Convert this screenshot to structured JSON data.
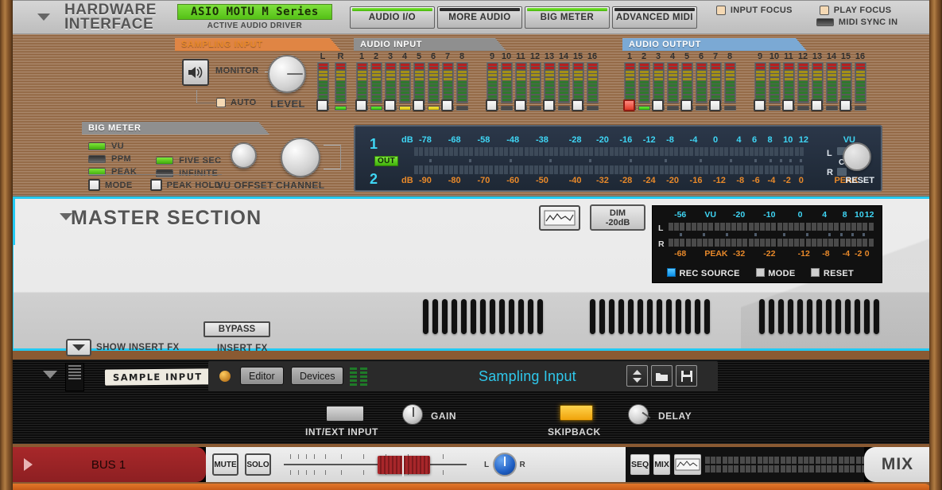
{
  "hardware": {
    "title_line1": "HARDWARE",
    "title_line2": "INTERFACE",
    "driver_value": "ASIO MOTU M Series",
    "driver_caption": "ACTIVE AUDIO DRIVER",
    "nav_buttons": [
      {
        "label": "AUDIO I/O",
        "active": true
      },
      {
        "label": "MORE AUDIO",
        "active": false
      },
      {
        "label": "BIG METER",
        "active": true
      },
      {
        "label": "ADVANCED MIDI",
        "active": false
      }
    ],
    "focus_options": [
      {
        "label": "INPUT FOCUS",
        "type": "square"
      },
      {
        "label": "PLAY FOCUS",
        "type": "square"
      },
      {
        "label": "MIDI SYNC IN",
        "type": "wide"
      }
    ]
  },
  "sampling_input": {
    "banner": "SAMPLING INPUT",
    "monitor_label": "MONITOR",
    "auto_label": "AUTO",
    "level_label": "LEVEL",
    "channels": [
      "L",
      "R"
    ],
    "clip_leds": [
      "green",
      "green"
    ]
  },
  "audio_input": {
    "banner": "AUDIO INPUT",
    "channels": [
      "1",
      "2",
      "3",
      "4",
      "5",
      "6",
      "7",
      "8",
      "9",
      "10",
      "11",
      "12",
      "13",
      "14",
      "15",
      "16"
    ],
    "clip_leds": [
      "green",
      "green",
      "yellow",
      "yellow",
      "yellow",
      "yellow",
      "off",
      "off",
      "off",
      "off",
      "off",
      "off",
      "off",
      "off",
      "off",
      "off"
    ]
  },
  "audio_output": {
    "banner": "AUDIO OUTPUT",
    "channels": [
      "1",
      "2",
      "3",
      "4",
      "5",
      "6",
      "7",
      "8",
      "9",
      "10",
      "11",
      "12",
      "13",
      "14",
      "15",
      "16"
    ],
    "clip_leds": [
      "green",
      "green",
      "off",
      "off",
      "off",
      "off",
      "off",
      "off",
      "off",
      "off",
      "off",
      "off",
      "off",
      "off",
      "off",
      "off"
    ],
    "checkbox_active_index": 0
  },
  "big_meter": {
    "banner": "BIG METER",
    "leds": [
      {
        "label": "VU",
        "on": true
      },
      {
        "label": "PPM",
        "on": false
      },
      {
        "label": "PEAK",
        "on": true
      },
      {
        "label": "FIVE SEC",
        "on": true
      },
      {
        "label": "INFINITE",
        "on": false
      }
    ],
    "checkboxes": [
      {
        "label": "MODE"
      },
      {
        "label": "PEAK HOLD"
      }
    ],
    "vu_offset_label": "VU OFFSET",
    "channel_label": "CHANNEL",
    "reset_label": "RESET",
    "display": {
      "row1_number": "1",
      "row2_number": "2",
      "out_badge": "OUT",
      "vu_unit": "dB",
      "vu_scale": [
        "-78",
        "-68",
        "-58",
        "-48",
        "-38",
        "-28",
        "-20",
        "-16",
        "-12",
        "-8",
        "-4",
        "0",
        "4",
        "6",
        "8",
        "10",
        "12"
      ],
      "vu_suffix": "VU",
      "peak_unit": "dB",
      "peak_scale": [
        "-90",
        "-80",
        "-70",
        "-60",
        "-50",
        "-40",
        "-32",
        "-28",
        "-24",
        "-20",
        "-16",
        "-12",
        "-8",
        "-6",
        "-4",
        "-2",
        "0"
      ],
      "peak_suffix": "PEAK",
      "left_label": "L",
      "right_label": "R",
      "clip_label": "CLIP"
    }
  },
  "master_section": {
    "title": "MASTER SECTION",
    "dim_line1": "DIM",
    "dim_line2": "-20dB",
    "show_insert_fx": "SHOW INSERT FX",
    "bypass": "BYPASS",
    "insert_fx": "INSERT FX",
    "meter": {
      "left_label": "L",
      "right_label": "R",
      "vu_scale": [
        "-56",
        "VU",
        "-20",
        "-10",
        "0",
        "4",
        "8",
        "10",
        "12"
      ],
      "peak_scale": [
        "-68",
        "PEAK",
        "-32",
        "-22",
        "-12",
        "-8",
        "-4",
        "-2",
        "0"
      ],
      "options": [
        {
          "label": "REC SOURCE",
          "on": true
        },
        {
          "label": "MODE",
          "on": false
        },
        {
          "label": "RESET",
          "on": false
        }
      ]
    }
  },
  "sampler": {
    "tag": "SAMPLE INPUT",
    "editor_button": "Editor",
    "devices_button": "Devices",
    "title": "Sampling Input",
    "int_ext_label": "INT/EXT INPUT",
    "gain_label": "GAIN",
    "skipback_label": "SKIPBACK",
    "delay_label": "DELAY"
  },
  "bus": {
    "name": "BUS 1",
    "mute": "MUTE",
    "solo": "SOLO",
    "pan_left": "L",
    "pan_right": "R",
    "seq": "SEQ",
    "mix_small": "MIX",
    "mix_big": "MIX"
  },
  "colors": {
    "accent_cyan": "#23c9f2",
    "banner_orange": "#e08544",
    "banner_blue": "#7ba9d4",
    "led_green": "#54c016",
    "bus_red": "#a8282a"
  }
}
